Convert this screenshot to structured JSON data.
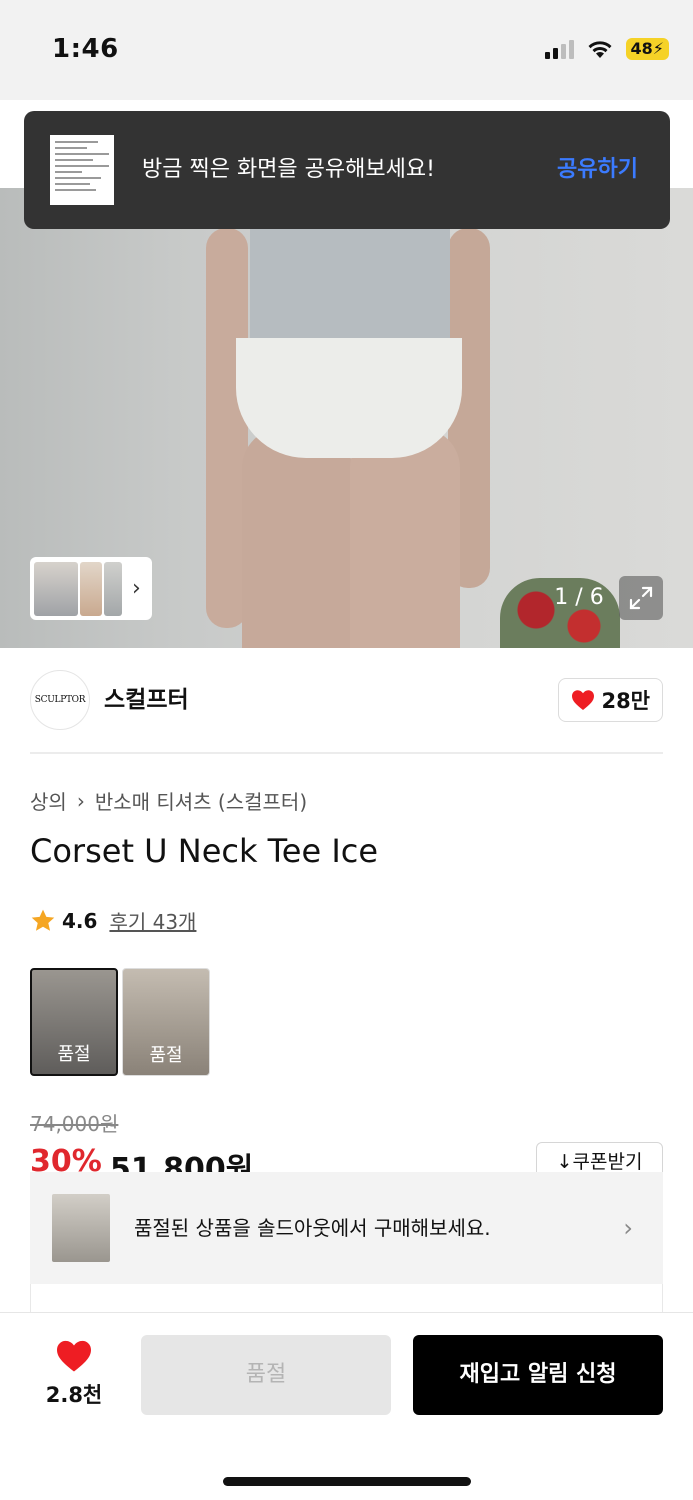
{
  "status_bar": {
    "time": "1:46",
    "battery": "48"
  },
  "toast": {
    "message": "방금 찍은 화면을 공유해보세요!",
    "action": "공유하기"
  },
  "gallery": {
    "page_indicator": "1 / 6",
    "current_page": 1,
    "total_pages": 6
  },
  "brand": {
    "logo_text": "SCULPTOR",
    "name": "스컬프터",
    "likes": "28만"
  },
  "breadcrumb": {
    "level1": "상의",
    "level2": "반소매 티셔츠 (스컬프터)"
  },
  "product": {
    "title": "Corset U Neck Tee Ice",
    "rating": "4.6",
    "reviews": "후기 43개",
    "variants": [
      {
        "label": "품절",
        "selected": true
      },
      {
        "label": "품절",
        "selected": false
      }
    ],
    "original_price": "74,000원",
    "discount": "30%",
    "sale_price": "51,800원",
    "coupon_label": "쿠폰받기"
  },
  "soldout_banner": {
    "text": "품절된 상품을 솔드아웃에서 구매해보세요."
  },
  "bottom_bar": {
    "wish_count": "2.8천",
    "soldout_label": "품절",
    "restock_label": "재입고 알림 신청"
  },
  "colors": {
    "accent_blue": "#3b7bff",
    "sale_red": "#e0282e",
    "heart_red": "#ee1d23",
    "star": "#f5a623"
  }
}
